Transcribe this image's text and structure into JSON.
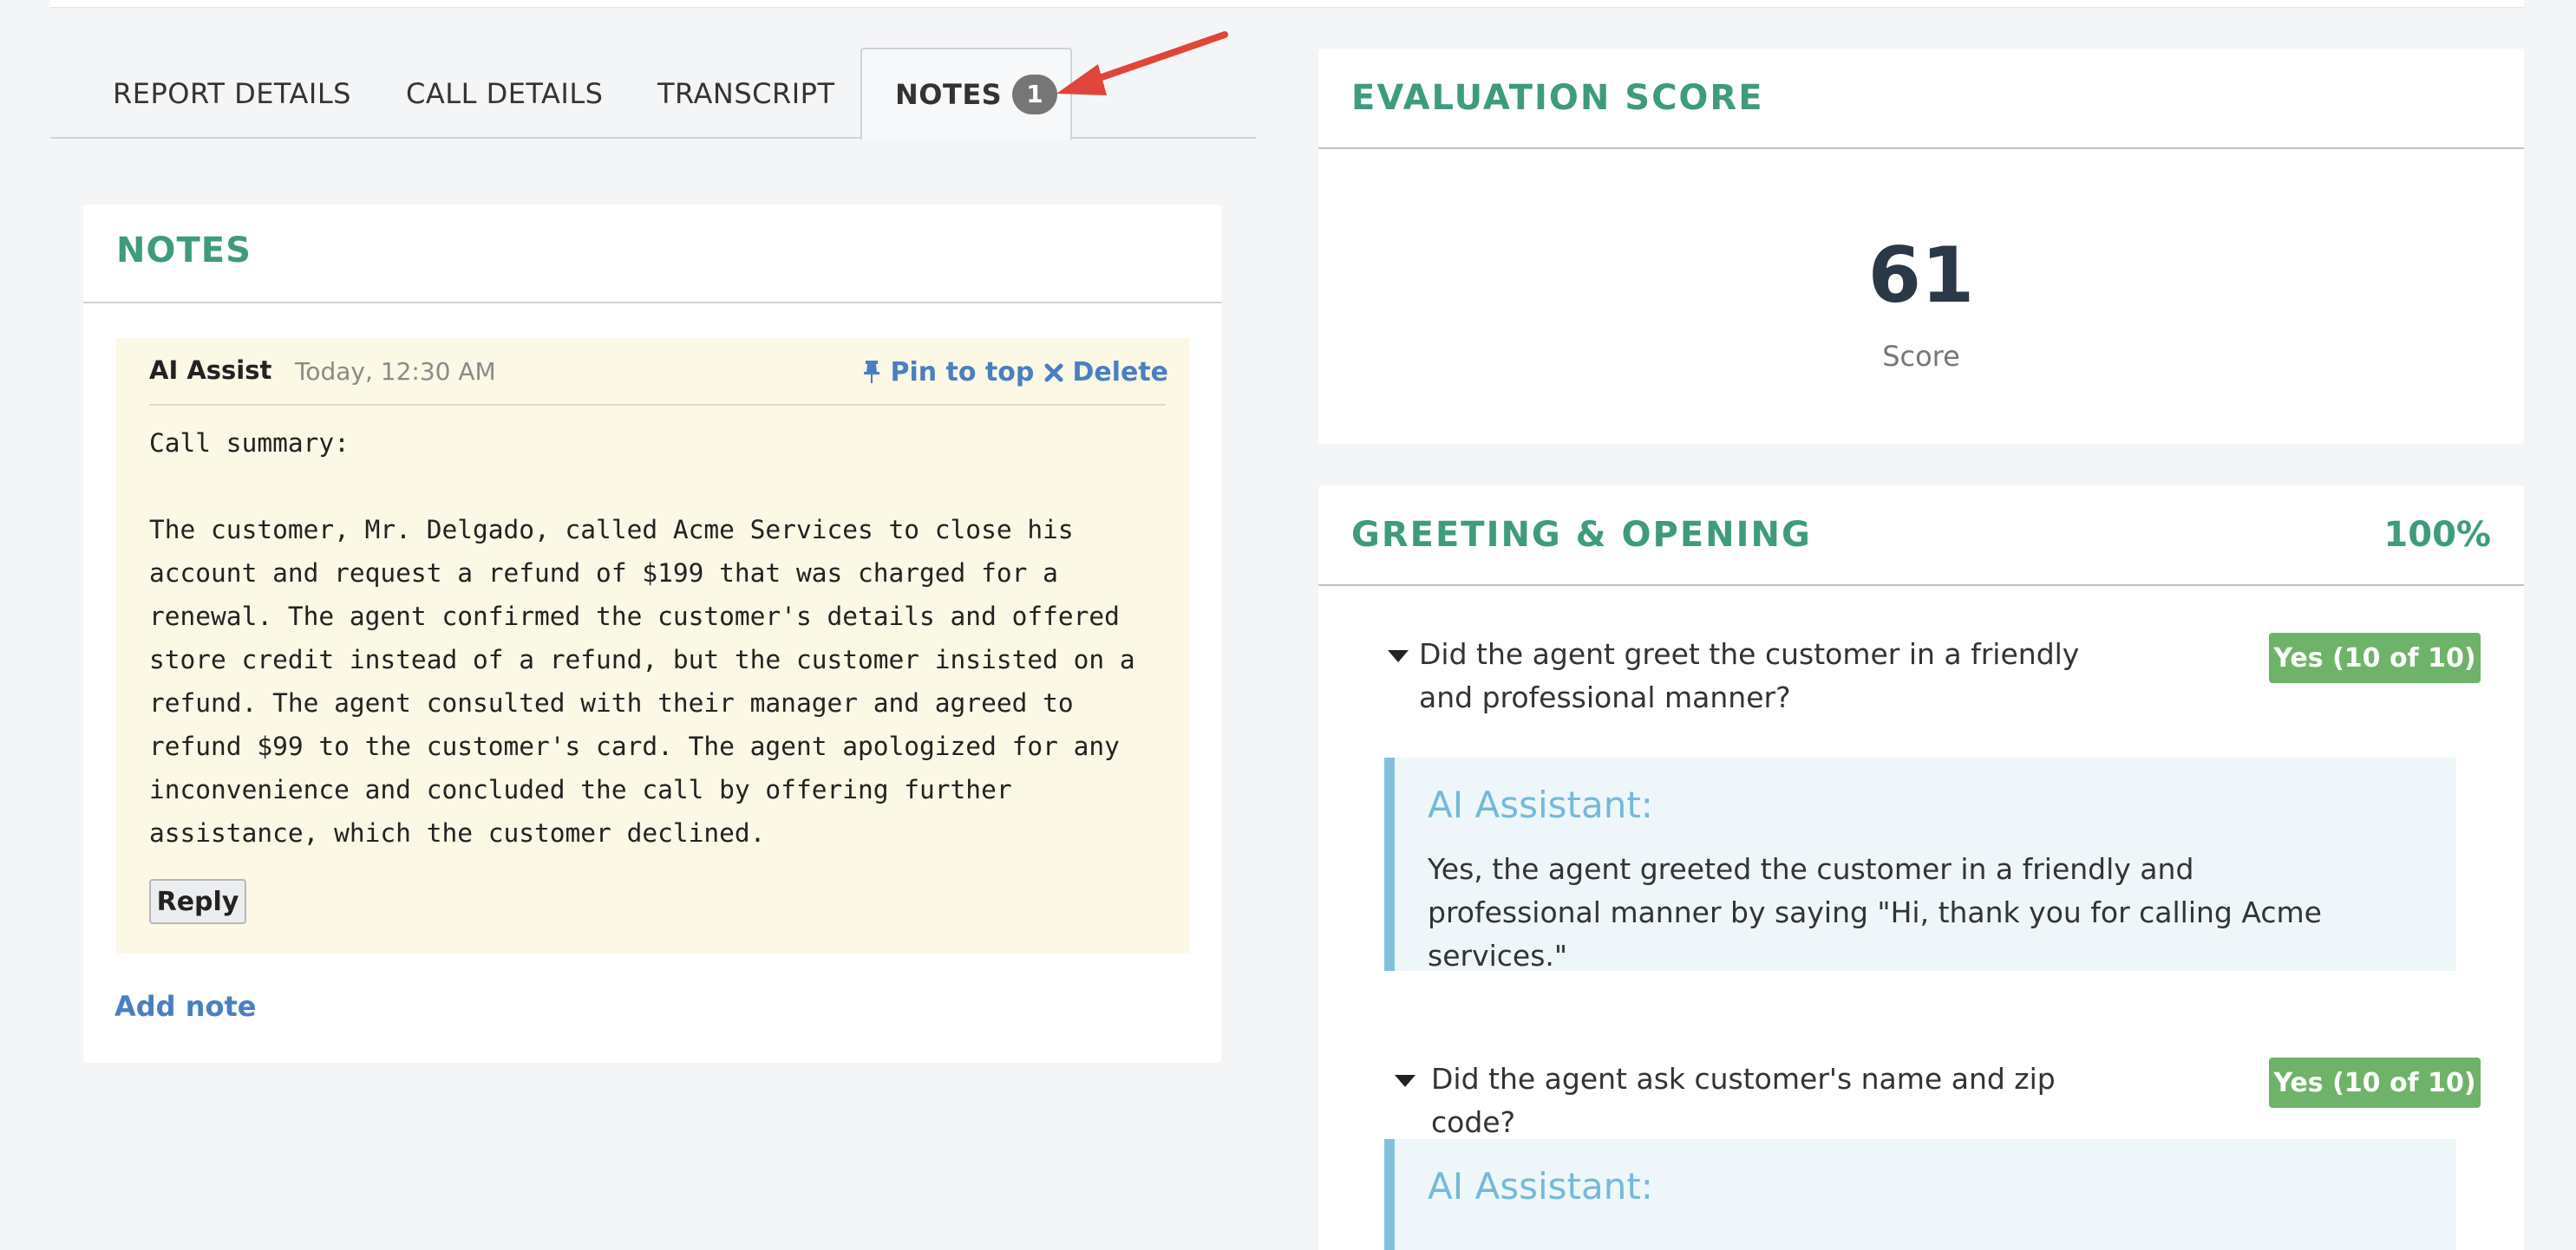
{
  "tabs": {
    "report_details": "REPORT DETAILS",
    "call_details": "CALL DETAILS",
    "transcript": "TRANSCRIPT",
    "notes": "NOTES",
    "notes_count": "1"
  },
  "notes_panel": {
    "title": "NOTES",
    "note": {
      "author": "AI Assist",
      "time": "Today, 12:30 AM",
      "pin_label": "Pin to top",
      "delete_label": "Delete",
      "body": "Call summary:\n\nThe customer, Mr. Delgado, called Acme Services to close his\naccount and request a refund of $199 that was charged for a\nrenewal. The agent confirmed the customer's details and offered\nstore credit instead of a refund, but the customer insisted on a\nrefund. The agent consulted with their manager and agreed to\nrefund $99 to the customer's card. The agent apologized for any\ninconvenience and concluded the call by offering further\nassistance, which the customer declined.",
      "reply_label": "Reply"
    },
    "add_note_label": "Add note"
  },
  "evaluation": {
    "title": "EVALUATION SCORE",
    "score": "61",
    "score_label": "Score"
  },
  "greeting": {
    "title": "GREETING & OPENING",
    "percent": "100%",
    "questions": [
      {
        "text": "Did the agent greet the customer in a friendly and professional manner?",
        "badge": "Yes (10 of 10)",
        "ai_title": "AI Assistant:",
        "ai_text": "Yes, the agent greeted the customer in a friendly and professional manner by saying \"Hi, thank you for calling Acme services.\""
      },
      {
        "text": "Did the agent ask customer's name and zip code?",
        "badge": "Yes (10 of 10)",
        "ai_title": "AI Assistant:",
        "ai_text": ""
      }
    ]
  },
  "colors": {
    "accent_green": "#3f9b7d",
    "link_blue": "#4a7fc1",
    "badge_green": "#6fb26a",
    "ai_blue": "#74b9d9",
    "annotation_red": "#e0453a"
  }
}
